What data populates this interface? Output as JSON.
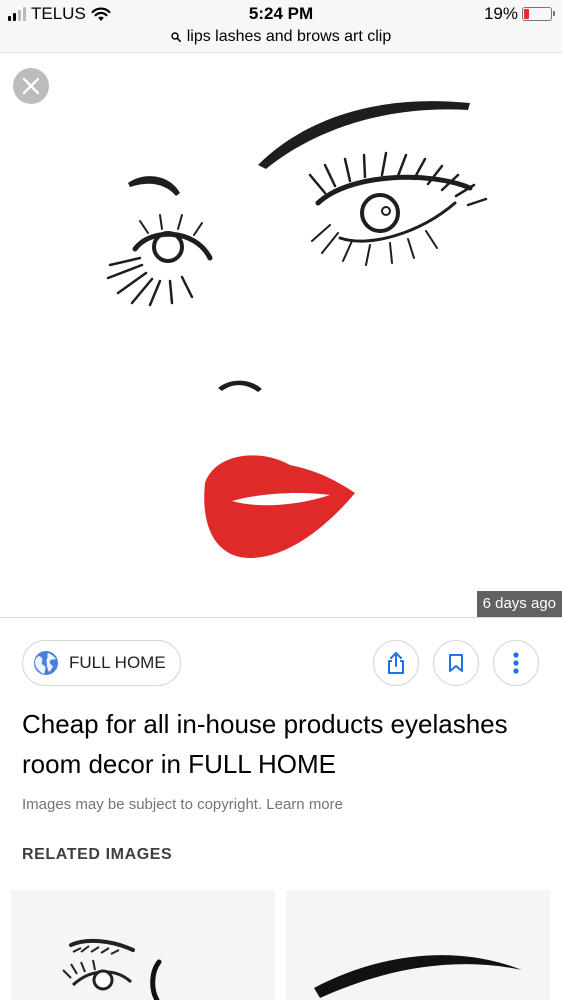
{
  "status_bar": {
    "carrier": "TELUS",
    "time": "5:24 PM",
    "battery_percent": "19%",
    "battery_level": 0.19,
    "battery_color": "#e52b2b",
    "signal_bars_total": 4,
    "signal_bars_filled": 2
  },
  "url_bar": {
    "query": "lips lashes and brows art clip",
    "icon": "search-icon"
  },
  "viewer": {
    "close_icon": "close-icon",
    "image_description_icon": "lips-lashes-brows-art",
    "time_ago": "6 days ago",
    "lip_color": "#e02a2a"
  },
  "result": {
    "source_name": "FULL HOME",
    "source_icon": "globe-icon",
    "globe_color": "#4a80d9",
    "accent_color": "#1a73e8",
    "title": "Cheap for all in-house products eyelashes room decor in FULL HOME",
    "copyright_note": "Images may be subject to copyright. Learn more",
    "actions": [
      {
        "icon": "share-icon"
      },
      {
        "icon": "bookmark-icon"
      },
      {
        "icon": "more-vertical-icon"
      }
    ]
  },
  "related": {
    "heading": "RELATED IMAGES",
    "thumbnails": [
      {
        "icon": "eye-brow-art-thumbnail"
      },
      {
        "icon": "brow-stroke-thumbnail"
      }
    ]
  }
}
